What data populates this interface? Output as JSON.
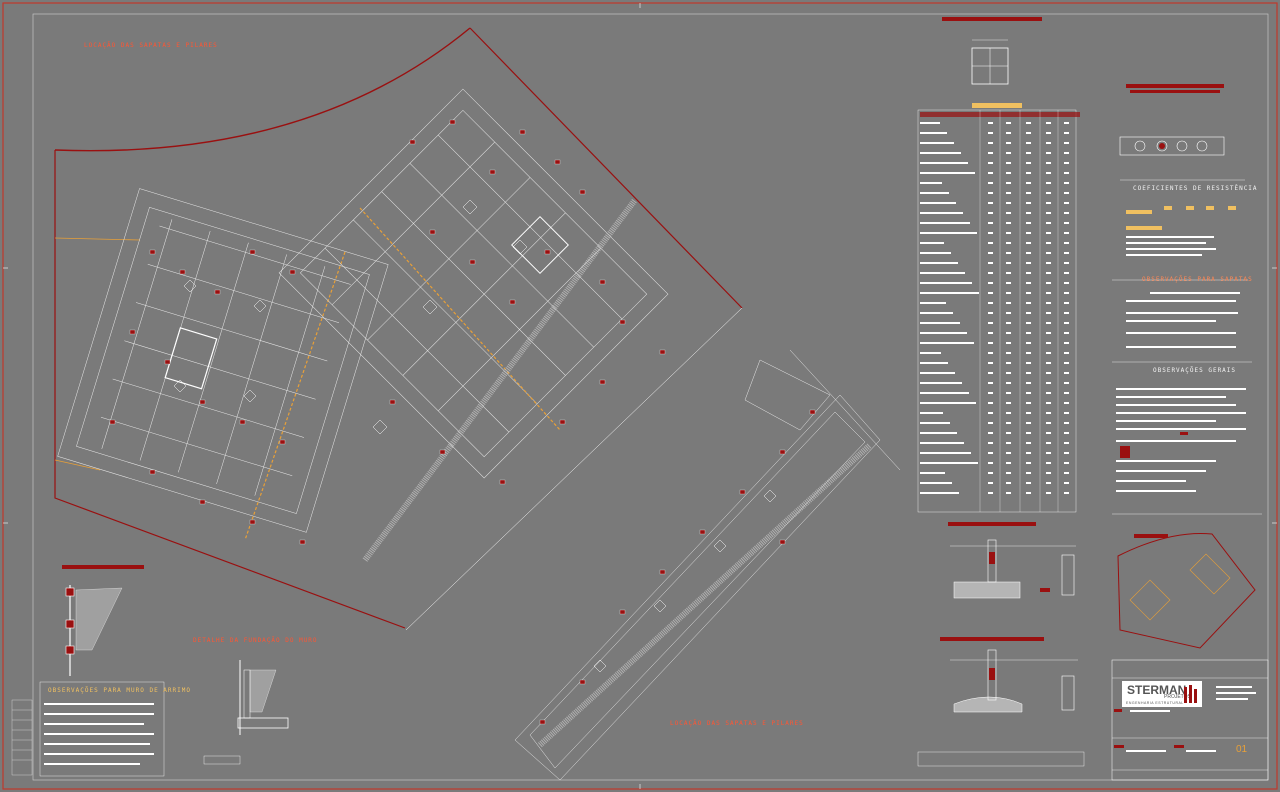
{
  "drawing": {
    "plan_title_main": "LOCAÇÃO DAS SAPATAS E PILARES",
    "plan_title_secondary": "LOCAÇÃO DAS SAPATAS E PILARES",
    "detail_wall_title": "DETALHE DA FUNDAÇÃO DO MURO",
    "notes_wall_title": "OBSERVAÇÕES PARA MURO DE ARRIMO",
    "coef_title": "COEFICIENTES DE RESISTÊNCIA",
    "notes_footing_title": "OBSERVAÇÕES PARA SAPATAS",
    "notes_general_title": "OBSERVAÇÕES GERAIS",
    "sheet_number": "01",
    "colors": {
      "background": "#7a7a7a",
      "linework": "#ffffff",
      "accent": "#9a1010",
      "label": "#ff5533",
      "highlight": "#f0c060"
    }
  },
  "title_block": {
    "company": "STERMAN",
    "company_sub": "PROJETOS",
    "company_tagline": "ENGENHARIA ESTRUTURAL"
  }
}
